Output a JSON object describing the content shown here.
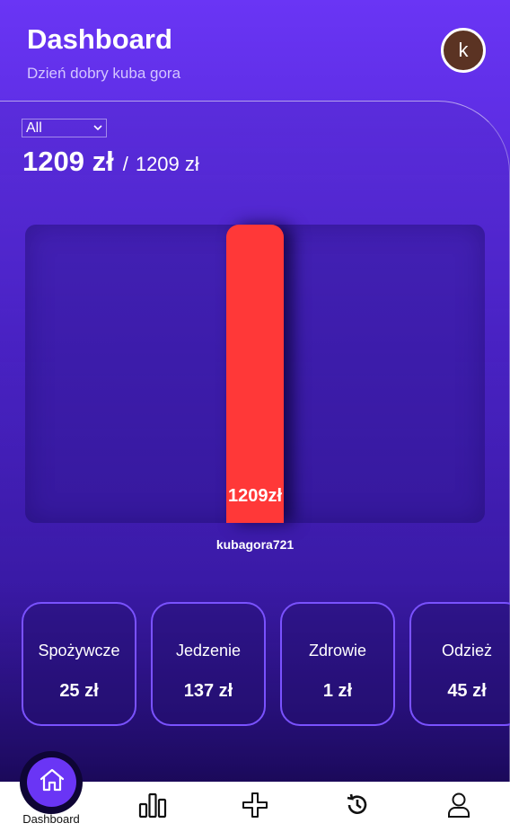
{
  "header": {
    "title": "Dashboard",
    "greeting": "Dzień dobry kuba gora",
    "avatar_initial": "k"
  },
  "filter": {
    "selected": "All"
  },
  "totals": {
    "spent": "1209 zł",
    "separator": "/",
    "limit": "1209 zł"
  },
  "chart_data": {
    "type": "bar",
    "categories": [
      "kubagora721"
    ],
    "values": [
      1209
    ],
    "data_labels": [
      "1209zł"
    ],
    "ylim": [
      0,
      1209
    ],
    "bar_color": "#ff3838",
    "title": "",
    "xlabel": "",
    "ylabel": "",
    "grid": false
  },
  "categories": [
    {
      "name": "Spożywcze",
      "amount": "25 zł"
    },
    {
      "name": "Jedzenie",
      "amount": "137 zł"
    },
    {
      "name": "Zdrowie",
      "amount": "1 zł"
    },
    {
      "name": "Odzież",
      "amount": "45 zł"
    }
  ],
  "nav": {
    "active_label": "Dashboard",
    "items": [
      {
        "icon": "home-icon",
        "label": "Dashboard"
      },
      {
        "icon": "bar-chart-icon"
      },
      {
        "icon": "plus-icon"
      },
      {
        "icon": "history-icon"
      },
      {
        "icon": "user-icon"
      }
    ]
  },
  "colors": {
    "accent": "#6a35f5",
    "bar": "#ff3838",
    "card_border": "#7a52ff"
  }
}
